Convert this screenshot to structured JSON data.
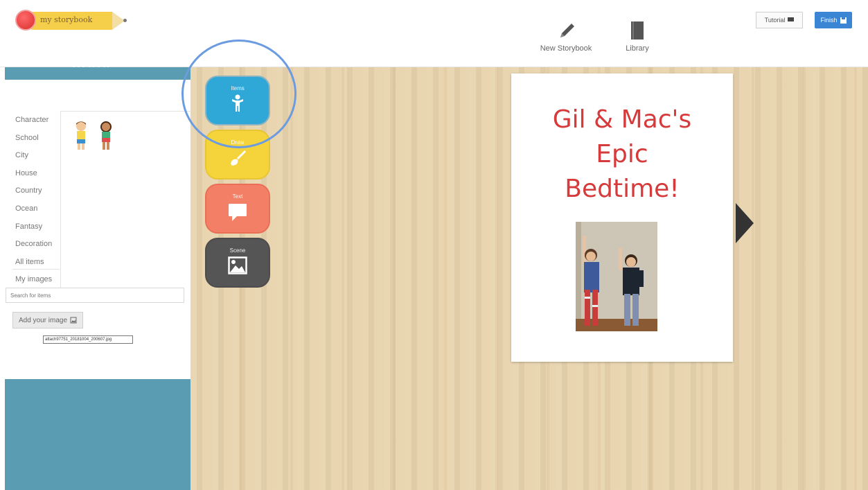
{
  "app": {
    "logo_text": "my storybook"
  },
  "nav": {
    "new_storybook_label": "New Storybook",
    "library_label": "Library",
    "tutorial_label": "Tutorial",
    "finish_label": "Finish"
  },
  "sidebar": {
    "heading": "Items",
    "categories": [
      "Character",
      "School",
      "City",
      "House",
      "Country",
      "Ocean",
      "Fantasy",
      "Decoration",
      "All items",
      "My images"
    ],
    "search_placeholder": "Search for items",
    "add_image_label": "Add your image",
    "filename": "attach97751_20181004_200607.jpg"
  },
  "tools": {
    "items_label": "Items",
    "draw_label": "Draw",
    "text_label": "Text",
    "scene_label": "Scene"
  },
  "page": {
    "title_line1": "Gil & Mac's",
    "title_line2": "Epic",
    "title_line3": "Bedtime!"
  },
  "colors": {
    "sidebar_blue": "#5a9db2",
    "items_blue": "#2fa8d7",
    "draw_yellow": "#f4d43a",
    "text_coral": "#f37f66",
    "scene_gray": "#555555",
    "title_red": "#d63a3a",
    "finish_blue": "#3a86d4"
  }
}
